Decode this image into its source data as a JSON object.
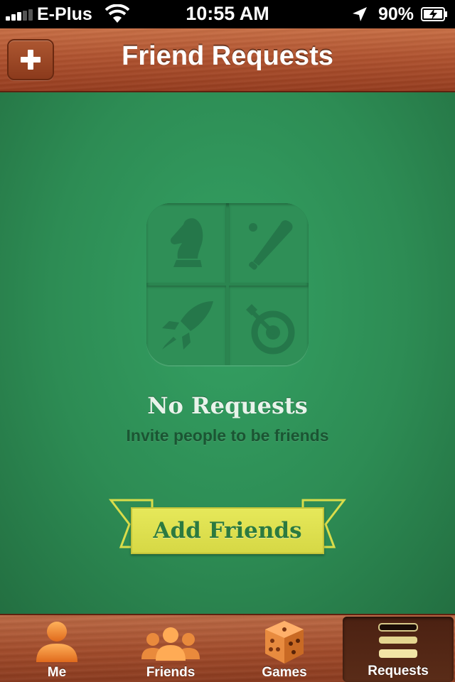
{
  "status_bar": {
    "carrier": "E-Plus",
    "time": "10:55 AM",
    "battery_percent": "90%",
    "signal_bars": 3,
    "icons": [
      "signal-icon",
      "wifi-icon",
      "location-icon",
      "battery-charging-icon"
    ]
  },
  "nav": {
    "title": "Friend Requests",
    "add_button_icon": "plus-icon"
  },
  "empty_state": {
    "title": "No Requests",
    "subtitle": "Invite people to be friends",
    "illustration_icons": [
      "chess-knight-icon",
      "baseball-bat-icon",
      "rocket-icon",
      "dart-target-icon"
    ]
  },
  "add_friends": {
    "label": "Add Friends"
  },
  "tabs": [
    {
      "label": "Me",
      "icon": "person-icon",
      "active": false
    },
    {
      "label": "Friends",
      "icon": "people-icon",
      "active": false
    },
    {
      "label": "Games",
      "icon": "dice-icon",
      "active": false
    },
    {
      "label": "Requests",
      "icon": "requests-icon",
      "active": true
    }
  ],
  "colors": {
    "felt_green": "#2e8c55",
    "wood_brown": "#b1532f",
    "ribbon_yellow": "#e6e85a",
    "ribbon_text": "#2c7a3f"
  }
}
